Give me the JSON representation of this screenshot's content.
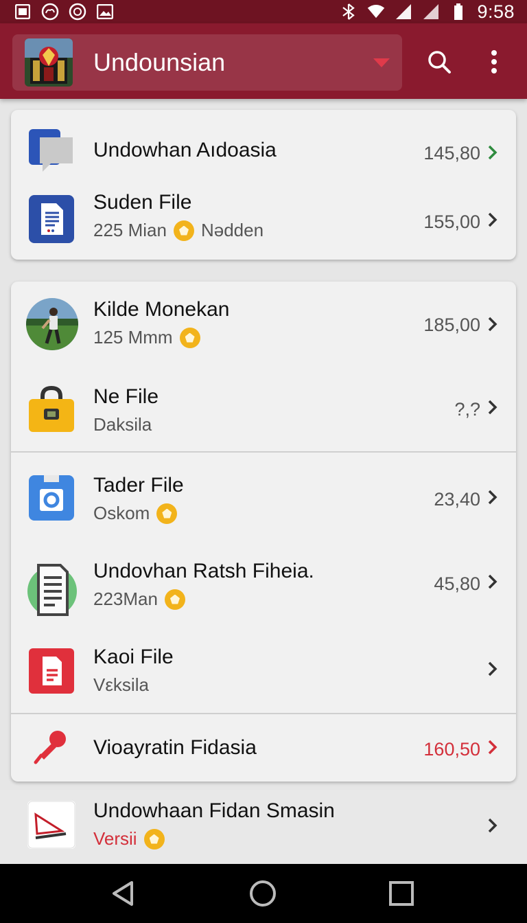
{
  "status_bar": {
    "time": "9:58",
    "left_icons": [
      "image-icon",
      "cloud-icon",
      "sync-icon",
      "photo-icon"
    ],
    "right_icons": [
      "bluetooth-icon",
      "wifi-icon",
      "signal-icon",
      "signal-icon",
      "battery-icon"
    ]
  },
  "app_bar": {
    "title": "Undounsian",
    "actions": [
      "search-icon",
      "more-vert-icon"
    ],
    "colors": {
      "bar": "#8a1a2e",
      "status": "#6e1322",
      "arrow": "#e03a4a"
    }
  },
  "card1": {
    "rows": [
      {
        "title": "Undowhan Aıdoasia",
        "subtitle": "",
        "value": "145,80",
        "icon": "chat-icon",
        "chevron_color": "#2e8b3e"
      },
      {
        "title": "Suden File",
        "subtitle": "225 Mian",
        "subtitle_extra": "Nədden",
        "value": "155,00",
        "icon": "document-icon"
      }
    ]
  },
  "card2": {
    "rows": [
      {
        "title": "Kilde Monekan",
        "subtitle": "125 Mmm",
        "value": "185,00",
        "icon": "photo-thumbnail"
      },
      {
        "title": "Ne File",
        "subtitle": "Daksila",
        "value": "?,?",
        "icon": "lock-icon"
      },
      {
        "title": "Tader File",
        "subtitle": "Oskom",
        "value": "23,40",
        "icon": "camera-icon"
      },
      {
        "title": "Undovhan Ratsh Fiheia.",
        "subtitle": "223Man",
        "value": "45,80",
        "icon": "clipboard-icon"
      },
      {
        "title": "Kaoi File",
        "subtitle": "Vεksila",
        "value": "",
        "icon": "pdf-file-icon"
      },
      {
        "title": "Vioayratin Fidasia",
        "subtitle": "",
        "value": "160,50",
        "icon": "pin-icon",
        "value_color": "#d32f3a"
      }
    ]
  },
  "bottom_row": {
    "title": "Undowhaan Fidan Smasin",
    "subtitle": "Versii",
    "icon": "pen-sign-icon",
    "subtitle_color": "#d32f3a"
  },
  "nav_bar": {
    "buttons": [
      "back-icon",
      "home-icon",
      "recents-icon"
    ]
  },
  "colors": {
    "badge": "#f2b31b",
    "accent_red": "#d32f3a",
    "accent_green": "#2e8b3e"
  }
}
